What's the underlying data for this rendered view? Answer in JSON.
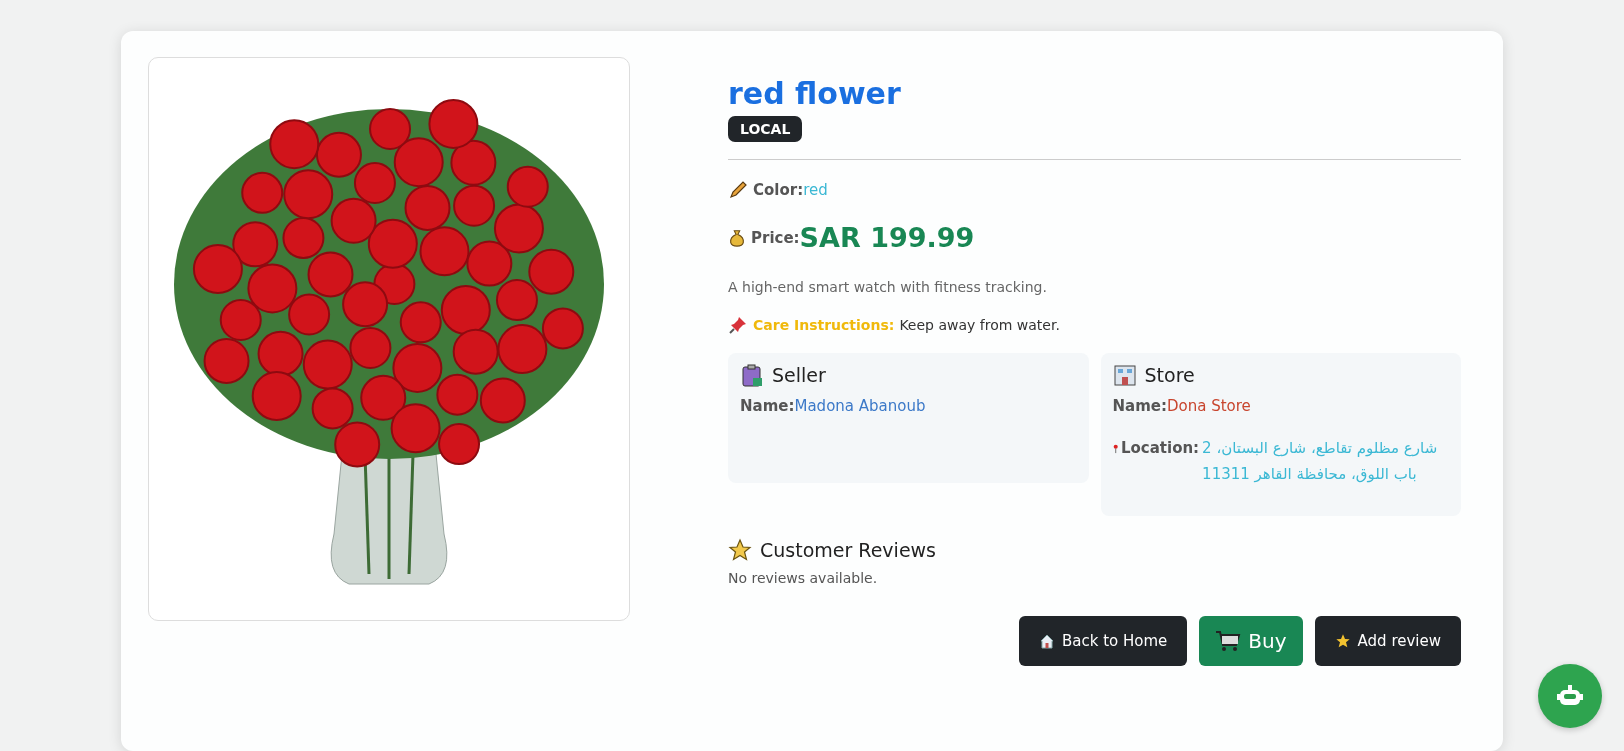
{
  "product": {
    "title": "red flower",
    "badge": "LOCAL",
    "details": [
      {
        "kind": "color",
        "label": "Color:",
        "value": "red"
      },
      {
        "kind": "price",
        "label": "Price:",
        "value": "SAR 199.99"
      }
    ],
    "description": "A high-end smart watch with fitness tracking.",
    "care": {
      "label": "Care Instructions:",
      "value": "Keep away from water."
    }
  },
  "seller": {
    "title": "Seller",
    "name_label": "Name:",
    "name": "Madona Abanoub"
  },
  "store": {
    "title": "Store",
    "name_label": "Name:",
    "name": "Dona Store",
    "location_label": "Location:",
    "location": "2 شارع مظلوم تقاطع، شارع البستان، باب اللوق، محافظة القاهر 11311"
  },
  "reviews": {
    "title": "Customer Reviews",
    "empty": "No reviews available."
  },
  "buttons": [
    {
      "kind": "home",
      "label": "Back to Home"
    },
    {
      "kind": "buy",
      "label": "Buy"
    },
    {
      "kind": "review",
      "label": "Add review"
    }
  ]
}
